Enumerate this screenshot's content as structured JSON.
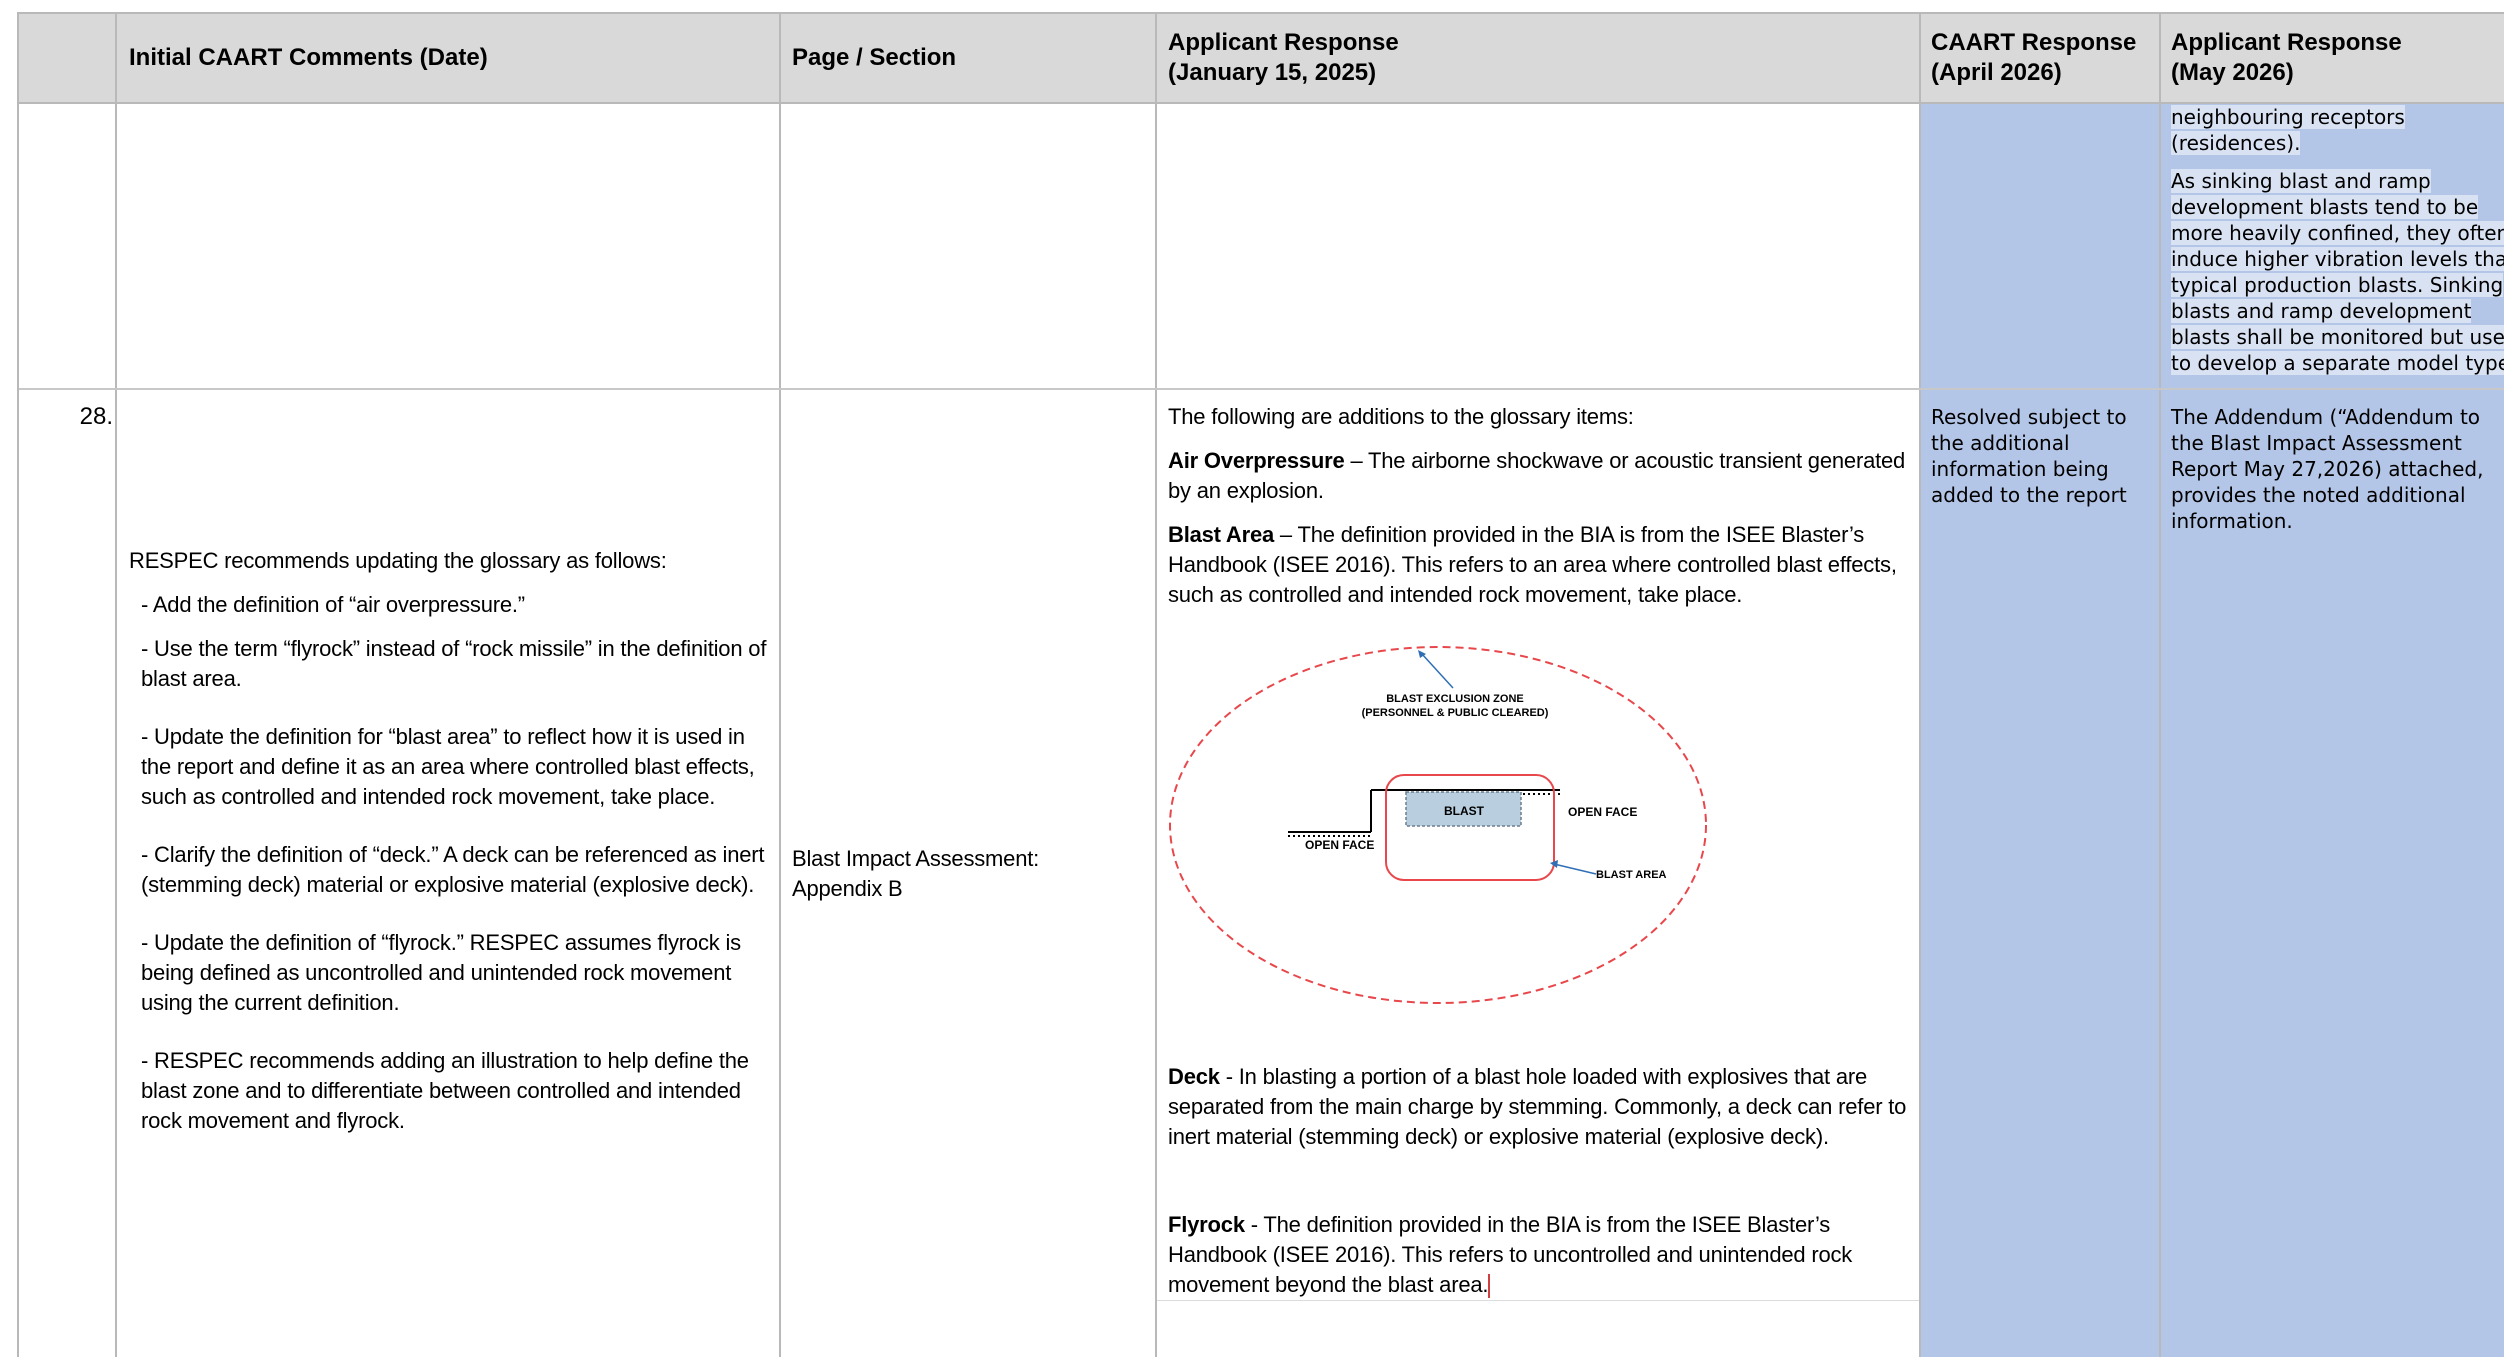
{
  "headers": {
    "comments": "Initial CAART Comments (Date)",
    "page": "Page / Section",
    "applicant_1_line1": "Applicant Response",
    "applicant_1_line2": "(January 15, 2025)",
    "caart_line1": "CAART Response",
    "caart_line2": "(April 2026)",
    "applicant_2_line1": "Applicant Response",
    "applicant_2_line2": "(May 2026)"
  },
  "prev_row": {
    "may_p1_line1": "neighbouring receptors",
    "may_p1_line2": "(residences).",
    "may_p2_lines": [
      "As sinking blast and ramp",
      "development blasts tend to be",
      "more heavily confined, they often",
      "induce higher vibration levels than",
      "typical production blasts. Sinking",
      "blasts and ramp development",
      "blasts shall be monitored but used",
      "to develop a separate model type"
    ]
  },
  "row28": {
    "number": "28.",
    "comments": {
      "intro": "RESPEC recommends updating the glossary as follows:",
      "items": [
        "- Add the definition of “air overpressure.”",
        "- Use the term “flyrock” instead of “rock missile” in the definition of blast area.",
        "- Update the definition for “blast area” to reflect how it is used in the report and define it as an area where controlled blast effects, such as controlled and intended rock movement, take place.",
        "- Clarify the definition of “deck.” A deck can be referenced as inert (stemming deck) material or explosive material (explosive deck).",
        "- Update the definition of “flyrock.” RESPEC assumes flyrock is being defined as uncontrolled and unintended rock movement using the current definition.",
        "- RESPEC recommends adding an illustration to help define the blast zone and to differentiate between controlled and intended rock movement and flyrock."
      ]
    },
    "page_section_line1": "Blast Impact Assessment:",
    "page_section_line2": "Appendix B",
    "applicant": {
      "intro": "The following are additions to the glossary items:",
      "air_term": "Air Overpressure",
      "air_def": " – The airborne shockwave or acoustic transient generated by an explosion.",
      "blast_term": "Blast Area",
      "blast_def": " – The definition provided in the BIA is from the ISEE Blaster’s Handbook (ISEE 2016). This refers to an area where controlled blast effects, such as controlled and intended rock movement, take place.",
      "deck_term": "Deck",
      "deck_def": " - In blasting a portion of a blast hole loaded with explosives that are separated from the main charge by stemming. Commonly, a deck can refer to inert material (stemming deck) or explosive material (explosive deck).",
      "flyrock_term": "Flyrock",
      "flyrock_def": " - The definition provided in the BIA is from the ISEE Blaster’s Handbook (ISEE 2016). This refers to uncontrolled and unintended rock movement beyond the blast area."
    },
    "diagram": {
      "exclusion_line1": "BLAST EXCLUSION ZONE",
      "exclusion_line2": "(PERSONNEL & PUBLIC CLEARED)",
      "blast": "BLAST",
      "open_face_left": "OPEN FACE",
      "open_face_right": "OPEN FACE",
      "blast_area": "BLAST AREA",
      "colors": {
        "exclusion": "#e8474b",
        "blast_area": "#e8474b",
        "blast_fill": "#b9cfe0",
        "arrow": "#2f6fb5"
      }
    },
    "caart": "Resolved subject to the additional information being added to the report",
    "may": "The Addendum (“Addendum to the Blast Impact Assessment Report May 27,2026) attached, provides the noted additional information."
  },
  "colors": {
    "header_bg": "#d9d9d9",
    "response_bg": "#b4c6e7",
    "grid": "#b9b9b9"
  }
}
